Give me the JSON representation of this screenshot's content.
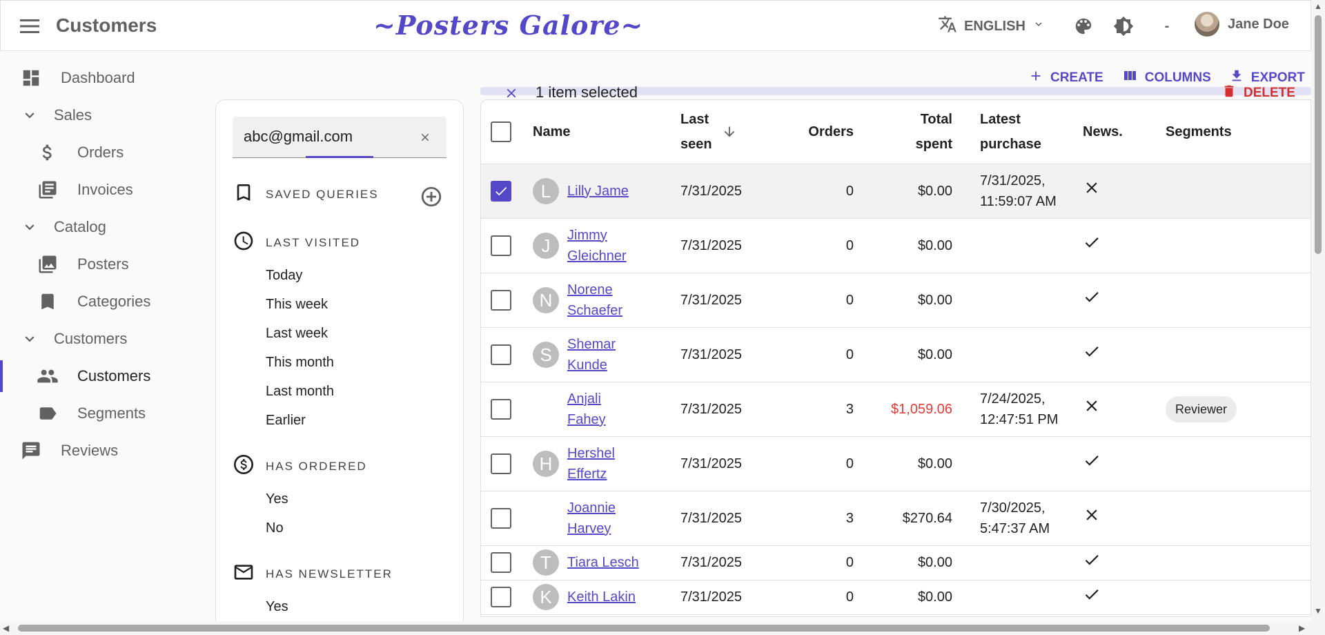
{
  "appbar": {
    "title": "Customers",
    "brand": "~Posters Galore~",
    "language": "ENGLISH",
    "loading_indicator": "-",
    "user_name": "Jane Doe"
  },
  "sidebar": {
    "dashboard": "Dashboard",
    "sales": "Sales",
    "orders": "Orders",
    "invoices": "Invoices",
    "catalog": "Catalog",
    "posters": "Posters",
    "categories": "Categories",
    "customers_group": "Customers",
    "customers": "Customers",
    "segments": "Segments",
    "reviews": "Reviews"
  },
  "filter": {
    "search_value": "abc@gmail.com",
    "saved_queries": "SAVED QUERIES",
    "last_visited": "LAST VISITED",
    "last_visited_options": [
      "Today",
      "This week",
      "Last week",
      "This month",
      "Last month",
      "Earlier"
    ],
    "has_ordered": "HAS ORDERED",
    "has_ordered_options": [
      "Yes",
      "No"
    ],
    "has_newsletter": "HAS NEWSLETTER",
    "has_newsletter_options": [
      "Yes"
    ]
  },
  "toolbar": {
    "create": "CREATE",
    "columns": "COLUMNS",
    "export": "EXPORT",
    "delete": "DELETE",
    "selection": "1 item selected"
  },
  "table": {
    "headers": {
      "name": "Name",
      "last_seen_1": "Last",
      "last_seen_2": "seen",
      "orders": "Orders",
      "total_spent_1": "Total",
      "total_spent_2": "spent",
      "latest_purchase_1": "Latest",
      "latest_purchase_2": "purchase",
      "news": "News.",
      "segments": "Segments"
    },
    "rows": [
      {
        "initial": "L",
        "name_1": "Lilly Jame",
        "name_2": "",
        "last_seen": "7/31/2025",
        "orders": "0",
        "total_spent": "$0.00",
        "purchase_1": "7/31/2025,",
        "purchase_2": "11:59:07 AM",
        "newsletter": false,
        "segment": "",
        "selected": true
      },
      {
        "initial": "J",
        "name_1": "Jimmy",
        "name_2": "Gleichner",
        "last_seen": "7/31/2025",
        "orders": "0",
        "total_spent": "$0.00",
        "purchase_1": "",
        "purchase_2": "",
        "newsletter": true,
        "segment": "",
        "selected": false
      },
      {
        "initial": "N",
        "name_1": "Norene",
        "name_2": "Schaefer",
        "last_seen": "7/31/2025",
        "orders": "0",
        "total_spent": "$0.00",
        "purchase_1": "",
        "purchase_2": "",
        "newsletter": true,
        "segment": "",
        "selected": false
      },
      {
        "initial": "S",
        "name_1": "Shemar",
        "name_2": "Kunde",
        "last_seen": "7/31/2025",
        "orders": "0",
        "total_spent": "$0.00",
        "purchase_1": "",
        "purchase_2": "",
        "newsletter": true,
        "segment": "",
        "selected": false
      },
      {
        "initial": "",
        "name_1": "Anjali",
        "name_2": "Fahey",
        "last_seen": "7/31/2025",
        "orders": "3",
        "total_spent": "$1,059.06",
        "purchase_1": "7/24/2025,",
        "purchase_2": "12:47:51 PM",
        "newsletter": false,
        "segment": "Reviewer",
        "selected": false
      },
      {
        "initial": "H",
        "name_1": "Hershel",
        "name_2": "Effertz",
        "last_seen": "7/31/2025",
        "orders": "0",
        "total_spent": "$0.00",
        "purchase_1": "",
        "purchase_2": "",
        "newsletter": true,
        "segment": "",
        "selected": false
      },
      {
        "initial": "",
        "name_1": "Joannie",
        "name_2": "Harvey",
        "last_seen": "7/31/2025",
        "orders": "3",
        "total_spent": "$270.64",
        "purchase_1": "7/30/2025,",
        "purchase_2": "5:47:37 AM",
        "newsletter": false,
        "segment": "",
        "selected": false
      },
      {
        "initial": "T",
        "name_1": "Tiara Lesch",
        "name_2": "",
        "last_seen": "7/31/2025",
        "orders": "0",
        "total_spent": "$0.00",
        "purchase_1": "",
        "purchase_2": "",
        "newsletter": true,
        "segment": "",
        "selected": false
      },
      {
        "initial": "K",
        "name_1": "Keith Lakin",
        "name_2": "",
        "last_seen": "7/31/2025",
        "orders": "0",
        "total_spent": "$0.00",
        "purchase_1": "",
        "purchase_2": "",
        "newsletter": true,
        "segment": "",
        "selected": false
      }
    ]
  },
  "colors": {
    "accent": "#5448c8",
    "danger": "#d32f2f",
    "spent_high": "#e53935"
  }
}
